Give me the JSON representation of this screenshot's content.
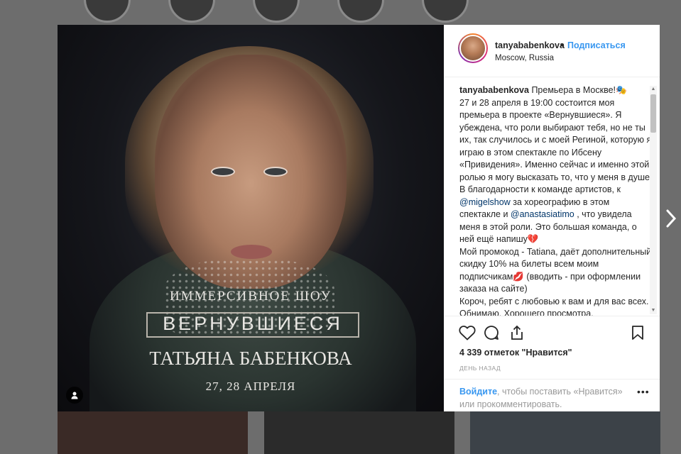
{
  "post": {
    "poster": {
      "subtitle": "ИММЕРСИВНОЕ ШОУ",
      "show_title": "ВЕРНУВШИЕСЯ",
      "actress": "ТАТЬЯНА БАБЕНКОВА",
      "dates": "27, 28 АПРЕЛЯ"
    }
  },
  "header": {
    "username": "tanyababenkova",
    "separator": "•",
    "follow_label": "Подписаться",
    "location": "Moscow, Russia"
  },
  "caption": {
    "author": "tanyababenkova",
    "line1": " Премьера в Москве!🎭",
    "line2": "27 и 28 апреля в 19:00 состоится моя премьера в проекте «Вернувшиеся». Я убеждена, что роли выбирают тебя, но не ты их, так случилось и с моей Региной, которую я играю в этом спектакле по Ибсену «Привидения». Именно сейчас и именно этой ролью я могу высказать то, что у меня в душе.",
    "line3a": "В благодарности к команде артистов, к ",
    "mention1": "@migelshow",
    "line3b": " за хореографию в этом спектакле и ",
    "mention2": "@anastasiatimo",
    "line3c": " , что увидела меня в этой роли. Это большая команда, о ней ещё напишу💔",
    "line4": "Мой промокод - Tatiana, даёт дополнительный скидку 10% на билеты всем моим подписчикам💋 (вводить - при оформлении заказа на сайте)",
    "line5": "Короч, ребят с любовью к вам и для вас всех. Обнимаю. Хорошего просмотра."
  },
  "stats": {
    "likes": "4 339 отметок \"Нравится\"",
    "time_ago": "ДЕНЬ НАЗАД"
  },
  "login": {
    "link": "Войдите",
    "rest": ", чтобы поставить «Нравится» или прокомментировать."
  },
  "more_label": "•••",
  "icons": {
    "like": "heart-icon",
    "comment": "comment-icon",
    "share": "share-icon",
    "save": "bookmark-icon",
    "tag": "user-tag-icon",
    "next": "chevron-right-icon"
  }
}
